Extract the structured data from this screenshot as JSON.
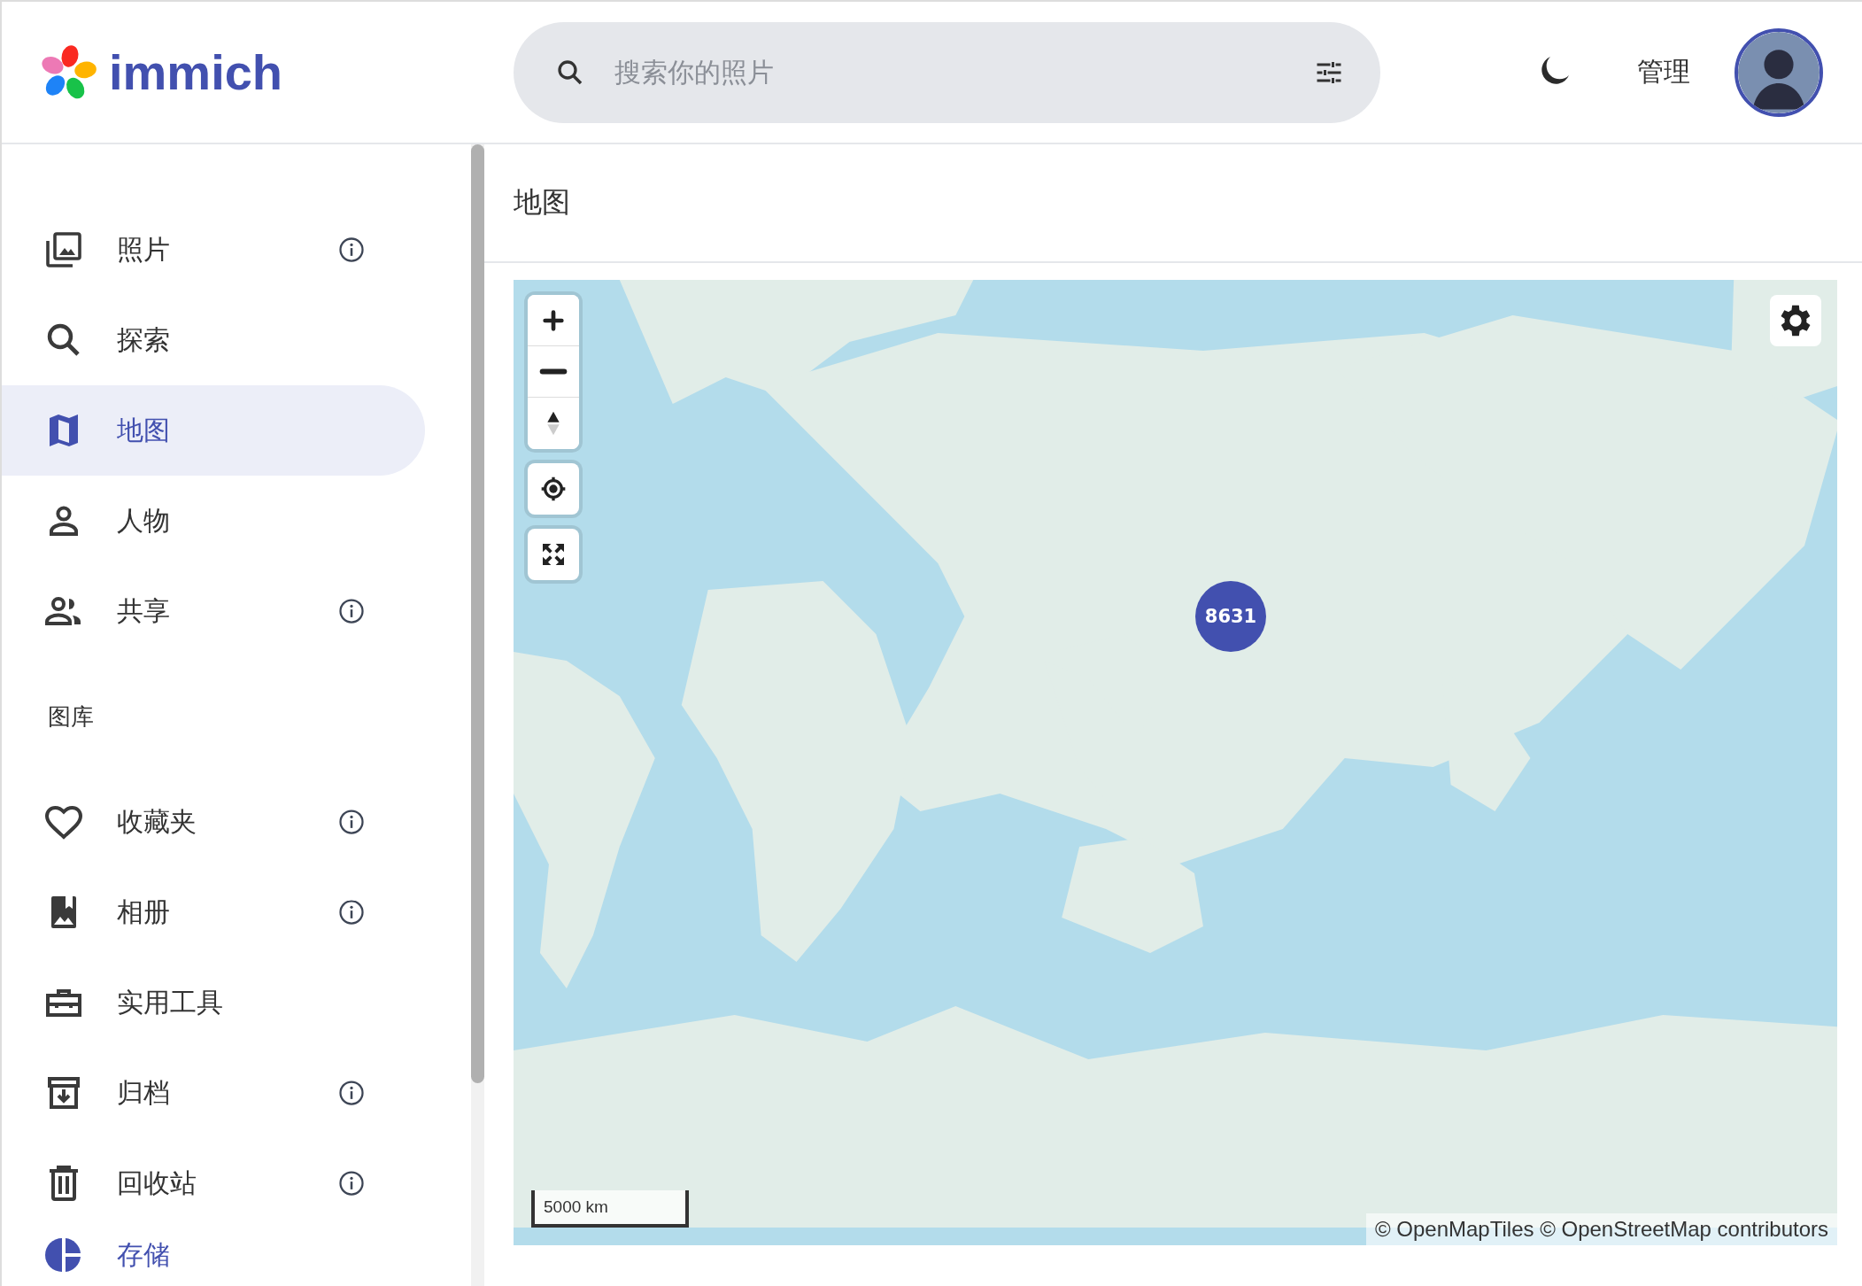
{
  "app": {
    "name": "immich"
  },
  "search": {
    "placeholder": "搜索你的照片"
  },
  "header": {
    "admin_link": "管理"
  },
  "sidebar": {
    "items": [
      {
        "label": "照片",
        "info": true,
        "selected": false
      },
      {
        "label": "探索",
        "info": false,
        "selected": false
      },
      {
        "label": "地图",
        "info": false,
        "selected": true
      },
      {
        "label": "人物",
        "info": false,
        "selected": false
      },
      {
        "label": "共享",
        "info": true,
        "selected": false
      }
    ],
    "section_title": "图库",
    "library_items": [
      {
        "label": "收藏夹",
        "info": true,
        "selected": false
      },
      {
        "label": "相册",
        "info": true,
        "selected": false
      },
      {
        "label": "实用工具",
        "info": false,
        "selected": false
      },
      {
        "label": "归档",
        "info": true,
        "selected": false
      },
      {
        "label": "回收站",
        "info": true,
        "selected": false
      }
    ],
    "storage": {
      "label": "存储"
    }
  },
  "page": {
    "title": "地图"
  },
  "map": {
    "cluster_count": "8631",
    "scale": "5000 km",
    "attribution": "© OpenMapTiles © OpenStreetMap contributors"
  }
}
